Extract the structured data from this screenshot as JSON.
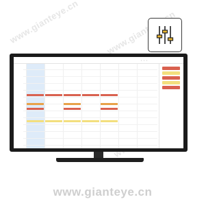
{
  "watermark": {
    "text": "www.gianteye.cn"
  },
  "footer": {
    "brand": "www.gianteye.cn"
  },
  "settings": {
    "icon": "sliders-icon"
  },
  "colors": {
    "monitor_bezel": "#1b1b1b",
    "today_column": "#deebf9",
    "event_red": "#d9614f",
    "event_orange": "#e8a24a",
    "event_yellow": "#f3df7e",
    "icon_accent": "#e8b430"
  },
  "calendar": {
    "nav_label": "",
    "range_label": "",
    "time_labels": [
      "",
      "",
      "",
      "",
      "",
      "",
      "",
      "",
      "",
      "",
      "",
      "",
      "",
      "",
      "",
      "",
      "",
      "",
      "",
      "",
      ""
    ],
    "days": [
      {
        "label": "",
        "today": true
      },
      {
        "label": "",
        "today": false
      },
      {
        "label": "",
        "today": false
      },
      {
        "label": "",
        "today": false
      },
      {
        "label": "",
        "today": false
      },
      {
        "label": "",
        "today": false
      },
      {
        "label": "",
        "today": false
      }
    ]
  }
}
